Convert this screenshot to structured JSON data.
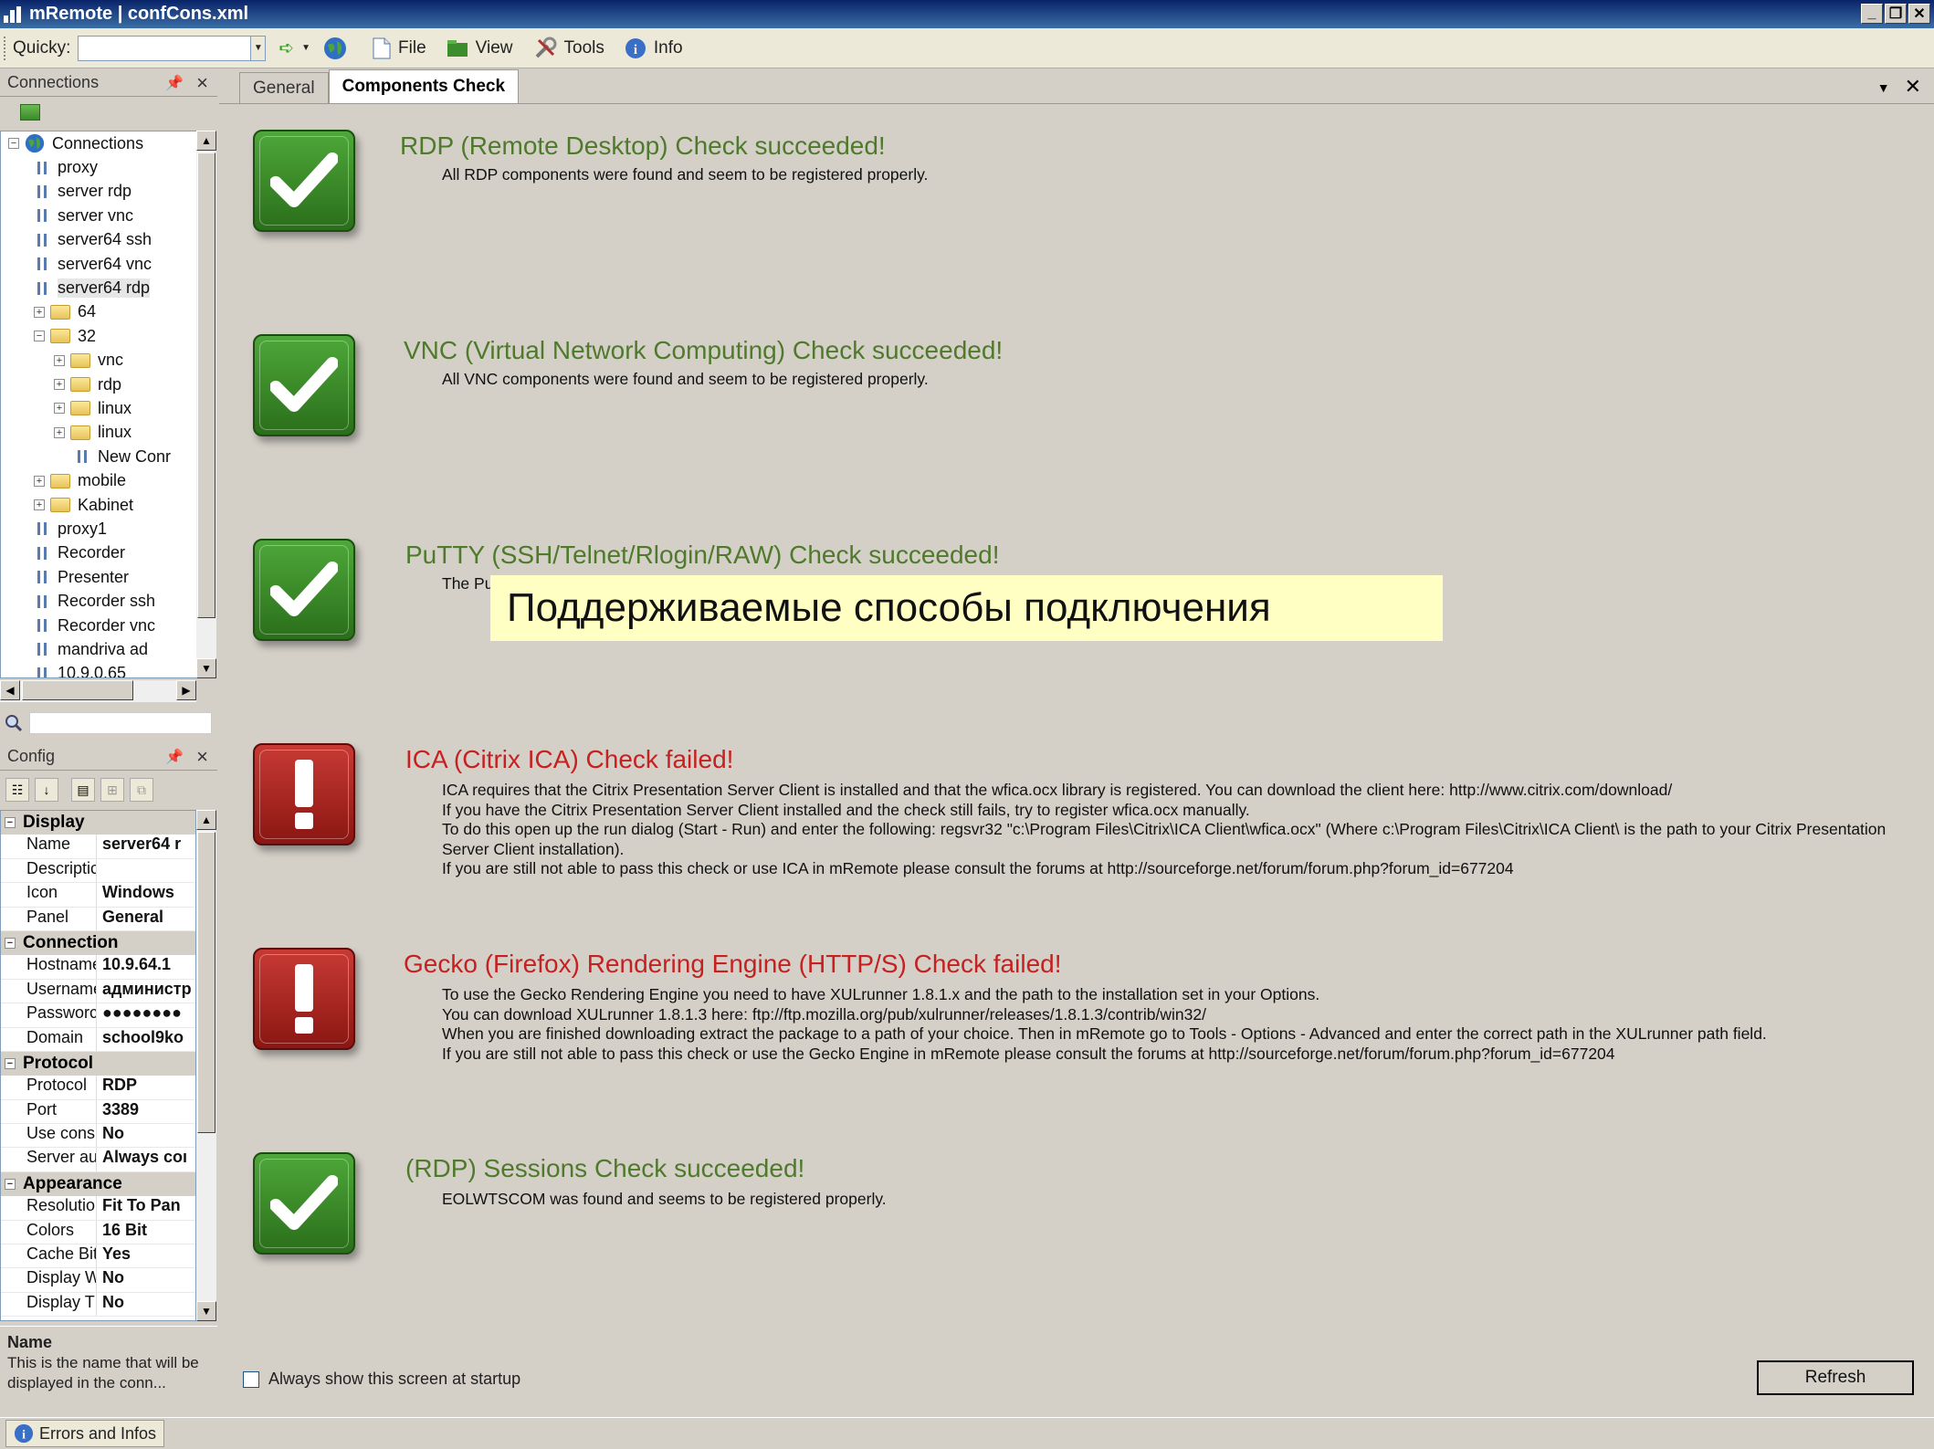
{
  "window": {
    "title": "mRemote | confCons.xml"
  },
  "toolbar": {
    "quicky_label": "Quicky:",
    "quicky_value": "",
    "file": "File",
    "view": "View",
    "tools": "Tools",
    "info": "Info"
  },
  "connections_panel": {
    "title": "Connections",
    "tree": [
      {
        "label": "Connections",
        "type": "root"
      },
      {
        "label": "proxy",
        "type": "conn"
      },
      {
        "label": "server rdp",
        "type": "conn"
      },
      {
        "label": "server vnc",
        "type": "conn"
      },
      {
        "label": "server64 ssh",
        "type": "conn"
      },
      {
        "label": "server64 vnc",
        "type": "conn"
      },
      {
        "label": "server64 rdp",
        "type": "conn",
        "selected": true
      },
      {
        "label": "64",
        "type": "folder"
      },
      {
        "label": "32",
        "type": "folder-open"
      },
      {
        "label": "vnc",
        "type": "subfolder"
      },
      {
        "label": "rdp",
        "type": "subfolder"
      },
      {
        "label": "linux",
        "type": "subfolder"
      },
      {
        "label": "linux",
        "type": "subfolder"
      },
      {
        "label": "New Conr",
        "type": "subconn"
      },
      {
        "label": "mobile",
        "type": "folder"
      },
      {
        "label": "Kabinet",
        "type": "folder"
      },
      {
        "label": "proxy1",
        "type": "conn"
      },
      {
        "label": "Recorder",
        "type": "conn"
      },
      {
        "label": "Presenter",
        "type": "conn"
      },
      {
        "label": "Recorder ssh",
        "type": "conn"
      },
      {
        "label": "Recorder vnc",
        "type": "conn"
      },
      {
        "label": "mandriva ad",
        "type": "conn"
      },
      {
        "label": "10.9.0.65",
        "type": "conn"
      }
    ]
  },
  "config_panel": {
    "title": "Config",
    "groups": [
      {
        "name": "Display",
        "rows": [
          [
            "Name",
            "server64 r"
          ],
          [
            "Descriptic",
            ""
          ],
          [
            "Icon",
            "Windows"
          ],
          [
            "Panel",
            "General"
          ]
        ]
      },
      {
        "name": "Connection",
        "rows": [
          [
            "Hostname",
            "10.9.64.1"
          ],
          [
            "Username",
            "администр"
          ],
          [
            "Passworc",
            "●●●●●●●●"
          ],
          [
            "Domain",
            "school9ko"
          ]
        ]
      },
      {
        "name": "Protocol",
        "rows": [
          [
            "Protocol",
            "RDP"
          ],
          [
            "Port",
            "3389"
          ],
          [
            "Use cons",
            "No"
          ],
          [
            "Server au",
            "Always coı"
          ]
        ]
      },
      {
        "name": "Appearance",
        "rows": [
          [
            "Resolutio",
            "Fit To Pan"
          ],
          [
            "Colors",
            "16 Bit"
          ],
          [
            "Cache Bit",
            "Yes"
          ],
          [
            "Display W",
            "No"
          ],
          [
            "Display T",
            "No"
          ]
        ]
      }
    ],
    "desc_title": "Name",
    "desc_text": "This is the name that will be displayed in the conn..."
  },
  "status": {
    "errors_tab": "Errors and Infos"
  },
  "tabs": [
    {
      "label": "General"
    },
    {
      "label": "Components Check",
      "active": true
    }
  ],
  "checks": [
    {
      "status": "ok",
      "title": "RDP (Remote Desktop) Check succeeded!",
      "lines": [
        "All RDP components were found and seem to be registered properly."
      ]
    },
    {
      "status": "ok",
      "title": "VNC (Virtual Network Computing) Check succeeded!",
      "lines": [
        "All VNC components were found and seem to be registered properly."
      ]
    },
    {
      "status": "ok",
      "title": "PuTTY (SSH/Telnet/Rlogin/RAW) Check succeeded!",
      "lines": [
        "The Pu"
      ]
    },
    {
      "status": "fail",
      "title": "ICA (Citrix ICA) Check failed!",
      "lines": [
        "ICA requires that the Citrix Presentation Server Client is installed and that the wfica.ocx library is registered. You can download the client here: http://www.citrix.com/download/",
        "If you have the Citrix Presentation Server Client installed and the check still fails, try to register wfica.ocx manually.",
        "To do this open up the run dialog (Start - Run) and enter the following: regsvr32 \"c:\\Program Files\\Citrix\\ICA Client\\wfica.ocx\" (Where c:\\Program Files\\Citrix\\ICA Client\\ is the path to your Citrix Presentation",
        "Server Client installation).",
        "If you are still not able to pass this check or use ICA in mRemote please consult the forums at http://sourceforge.net/forum/forum.php?forum_id=677204"
      ]
    },
    {
      "status": "fail",
      "title": "Gecko (Firefox) Rendering Engine (HTTP/S) Check failed!",
      "lines": [
        "To use the Gecko Rendering Engine you need to have XULrunner 1.8.1.x and the path to the installation set in your Options.",
        "You can download XULrunner 1.8.1.3 here: ftp://ftp.mozilla.org/pub/xulrunner/releases/1.8.1.3/contrib/win32/",
        "When you are finished downloading extract the package to a path of your choice. Then in mRemote go to Tools - Options - Advanced and enter the correct path in the XULrunner path field.",
        "If you are still not able to pass this check or use the Gecko Engine in mRemote please consult the forums at http://sourceforge.net/forum/forum.php?forum_id=677204"
      ]
    },
    {
      "status": "ok",
      "title": "(RDP) Sessions Check succeeded!",
      "lines": [
        "EOLWTSCOM was found and seems to be registered properly."
      ]
    }
  ],
  "overlay_caption": "Поддерживаемые способы подключения",
  "footer": {
    "startup_label": "Always show this screen at startup",
    "refresh": "Refresh"
  }
}
